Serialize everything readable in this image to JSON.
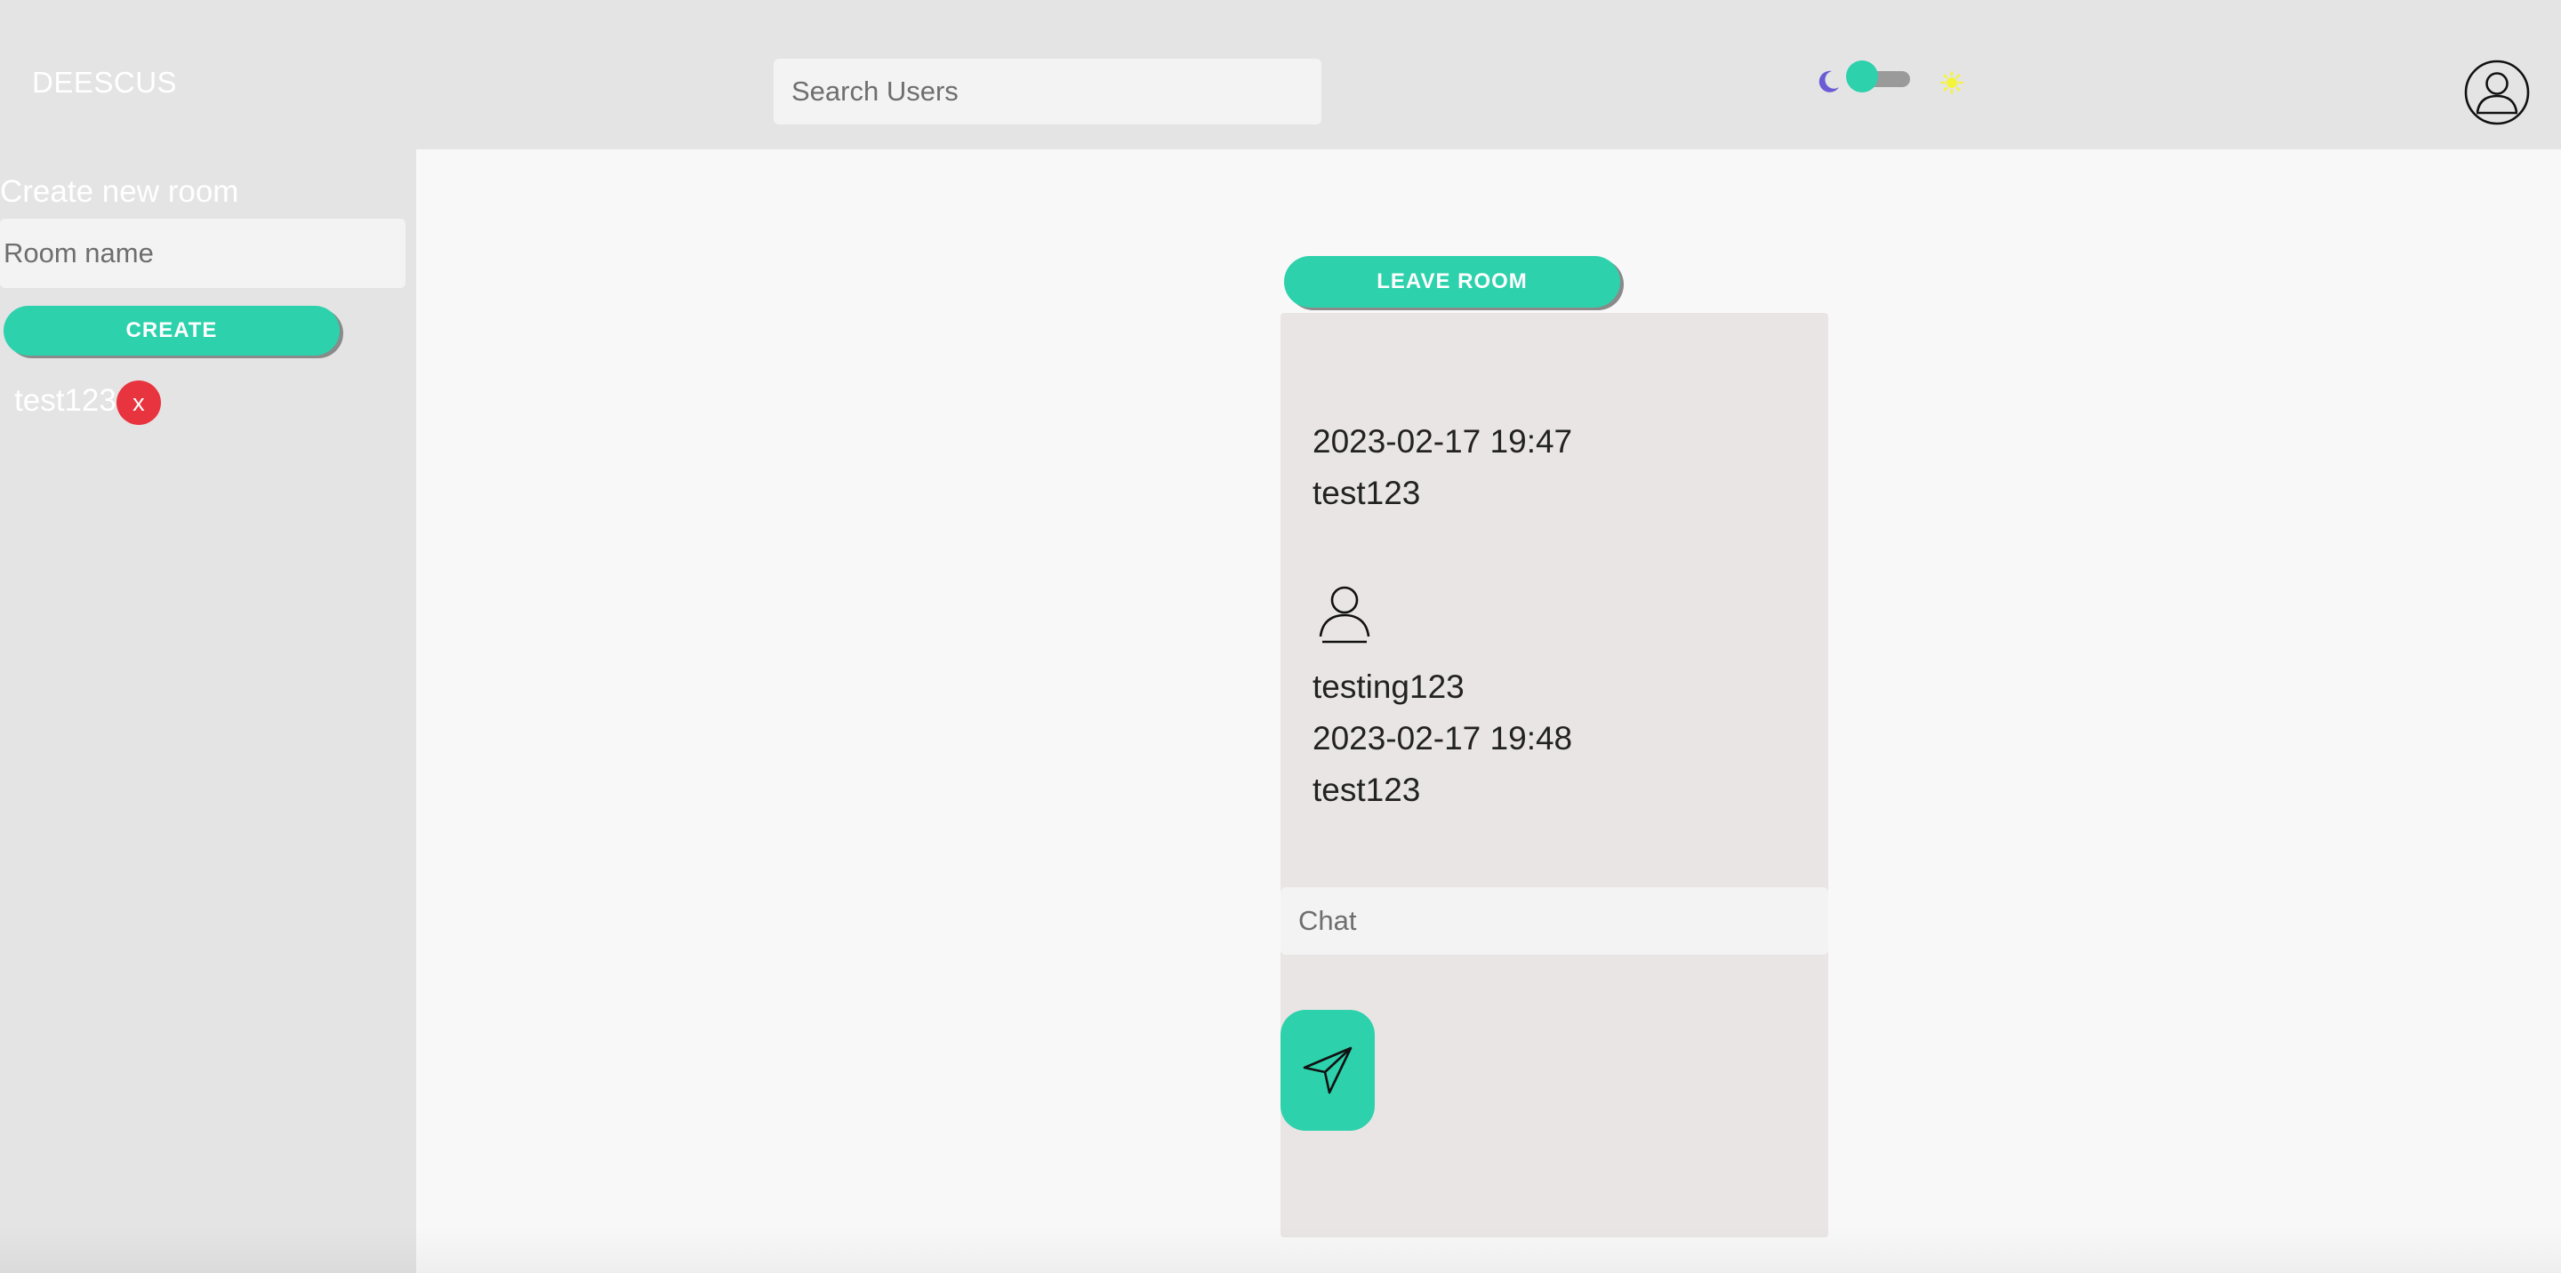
{
  "header": {
    "logo": "DEESCUS",
    "search_placeholder": "Search Users",
    "theme_toggle": {
      "state": "dark",
      "moon_icon": "moon-icon",
      "sun_icon": "sun-icon"
    },
    "avatar_icon": "user-circle-icon"
  },
  "sidebar": {
    "title": "Create new room",
    "room_input_placeholder": "Room name",
    "create_label": "CREATE",
    "rooms": [
      {
        "name": "test123",
        "delete_label": "x"
      }
    ]
  },
  "chat": {
    "leave_label": "LEAVE ROOM",
    "messages": [
      {
        "timestamp": "2023-02-17 19:47",
        "text": "test123"
      },
      {
        "author": "testing123",
        "timestamp": "2023-02-17 19:48",
        "text": "test123"
      }
    ],
    "input_placeholder": "Chat",
    "send_icon": "send-icon"
  },
  "colors": {
    "accent": "#2dd1ac",
    "danger": "#e8343f",
    "header_bg": "#e4e4e4",
    "panel_bg": "#e9e5e4",
    "moon": "#6b5cd6",
    "sun": "#f4f43a"
  }
}
